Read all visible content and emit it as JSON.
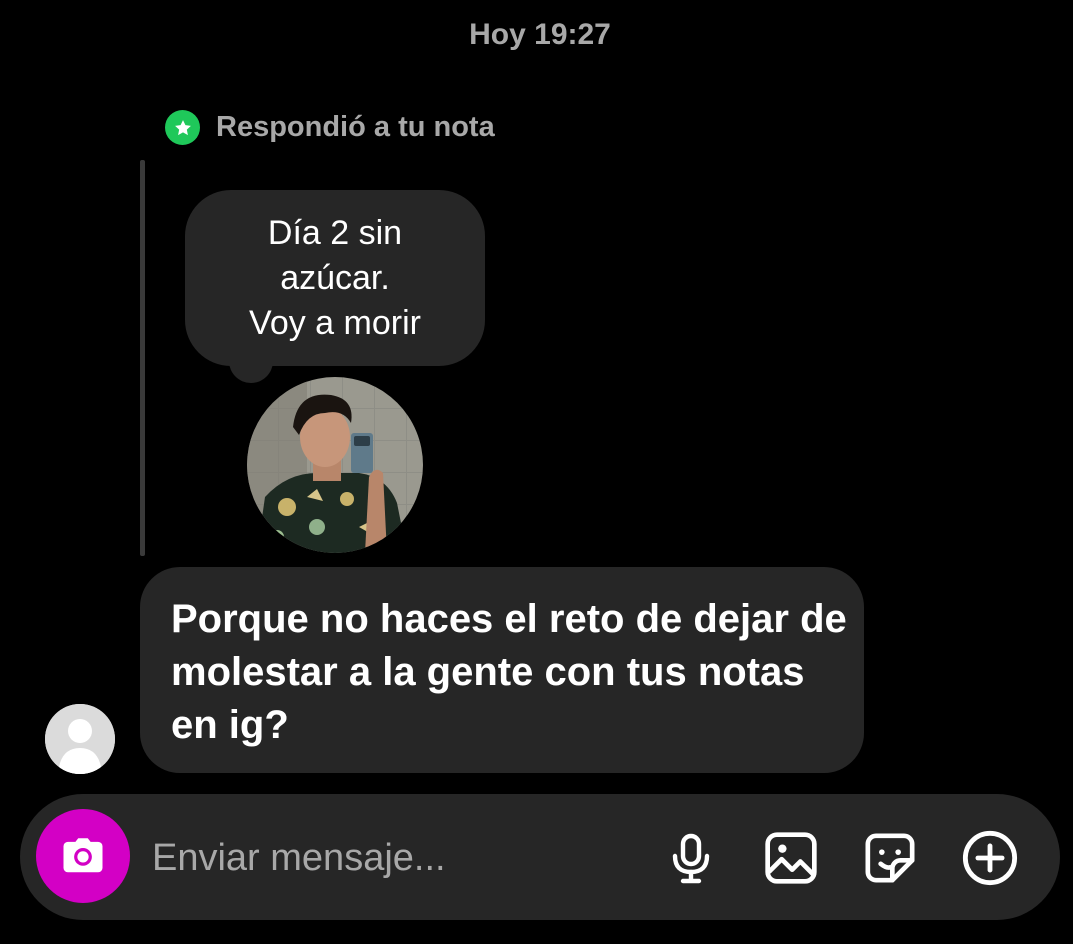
{
  "timestamp": "Hoy 19:27",
  "reply_context": {
    "label": "Respondió a tu nota",
    "badge_color": "#1fc85a",
    "badge_icon": "star-icon"
  },
  "note": {
    "lines": [
      "Día 2 sin",
      "azúcar.",
      "Voy a morir"
    ]
  },
  "message": {
    "text": "Porque no haces el reto de dejar de molestar a la gente con tus notas en ig?"
  },
  "composer": {
    "placeholder": "Enviar mensaje...",
    "camera_color": "#d300c5",
    "icons": [
      "microphone-icon",
      "gallery-icon",
      "sticker-icon",
      "add-icon"
    ]
  }
}
